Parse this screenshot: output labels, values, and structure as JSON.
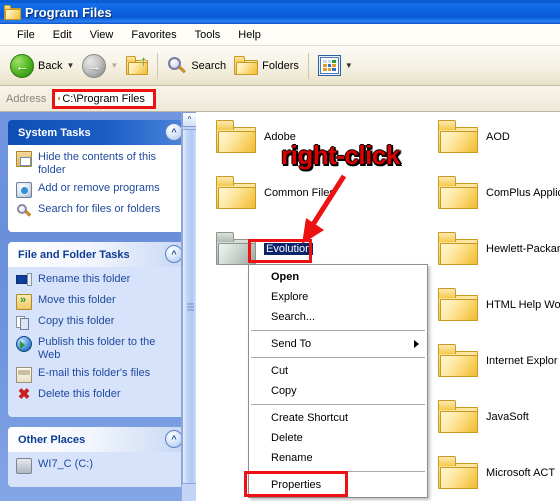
{
  "window": {
    "title": "Program Files",
    "icon": "folder-icon"
  },
  "menubar": {
    "items": [
      {
        "label": "File"
      },
      {
        "label": "Edit"
      },
      {
        "label": "View"
      },
      {
        "label": "Favorites"
      },
      {
        "label": "Tools"
      },
      {
        "label": "Help"
      }
    ]
  },
  "toolbar": {
    "back_label": "Back",
    "back_icon": "back-arrow-icon",
    "forward_icon": "forward-arrow-icon",
    "up_icon": "up-one-level-icon",
    "search_label": "Search",
    "search_icon": "magnifier-icon",
    "folders_label": "Folders",
    "folders_icon": "folders-icon",
    "views_icon": "views-icon",
    "dropdown_caret": "▼"
  },
  "address": {
    "label": "Address",
    "icon": "folder-icon",
    "value": "C:\\Program Files",
    "placeholder": "C:\\Program Files",
    "highlight_color": "#ee1111"
  },
  "sidebar": {
    "panels": [
      {
        "title": "System Tasks",
        "style": "blue",
        "collapse_icon": "chevron-up-icon",
        "tasks": [
          {
            "label": "Hide the contents of this folder",
            "icon": "hide-contents-icon"
          },
          {
            "label": "Add or remove programs",
            "icon": "add-remove-programs-icon"
          },
          {
            "label": "Search for files or folders",
            "icon": "search-icon"
          }
        ]
      },
      {
        "title": "File and Folder Tasks",
        "style": "white",
        "collapse_icon": "chevron-up-icon",
        "tasks": [
          {
            "label": "Rename this folder",
            "icon": "rename-icon"
          },
          {
            "label": "Move this folder",
            "icon": "move-icon"
          },
          {
            "label": "Copy this folder",
            "icon": "copy-icon"
          },
          {
            "label": "Publish this folder to the Web",
            "icon": "publish-web-icon"
          },
          {
            "label": "E-mail this folder's files",
            "icon": "email-icon"
          },
          {
            "label": "Delete this folder",
            "icon": "delete-x-icon"
          }
        ]
      },
      {
        "title": "Other Places",
        "style": "white",
        "collapse_icon": "chevron-up-icon",
        "tasks": [
          {
            "label": "WI7_C (C:)",
            "icon": "drive-icon"
          }
        ]
      }
    ],
    "scrollbar": {
      "up_arrow": "scroll-up-icon",
      "grip": "scrollbar-grip"
    }
  },
  "content": {
    "items": [
      {
        "name": "Adobe",
        "col": 0,
        "row": 0,
        "state": "normal"
      },
      {
        "name": "Common Files",
        "col": 0,
        "row": 1,
        "state": "normal"
      },
      {
        "name": "Evolution",
        "col": 0,
        "row": 2,
        "state": "selected"
      },
      {
        "name": "AOD",
        "col": 1,
        "row": 0,
        "state": "normal"
      },
      {
        "name": "ComPlus Applic",
        "col": 1,
        "row": 1,
        "state": "normal"
      },
      {
        "name": "Hewlett-Packar",
        "col": 1,
        "row": 2,
        "state": "normal"
      },
      {
        "name": "HTML Help Wor",
        "col": 1,
        "row": 3,
        "state": "normal"
      },
      {
        "name": "Internet Explor",
        "col": 1,
        "row": 4,
        "state": "normal"
      },
      {
        "name": "JavaSoft",
        "col": 1,
        "row": 5,
        "state": "normal"
      },
      {
        "name": "Microsoft ACT",
        "col": 1,
        "row": 6,
        "state": "normal"
      }
    ]
  },
  "annotation": {
    "text": "right-click",
    "color": "#dd0000",
    "arrow_icon": "red-arrow-icon"
  },
  "context_menu": {
    "items": [
      {
        "label": "Open",
        "type": "item",
        "bold": true,
        "submenu": false
      },
      {
        "label": "Explore",
        "type": "item",
        "bold": false,
        "submenu": false
      },
      {
        "label": "Search...",
        "type": "item",
        "bold": false,
        "submenu": false
      },
      {
        "label": "",
        "type": "separator"
      },
      {
        "label": "Send To",
        "type": "item",
        "bold": false,
        "submenu": true
      },
      {
        "label": "",
        "type": "separator"
      },
      {
        "label": "Cut",
        "type": "item",
        "bold": false,
        "submenu": false
      },
      {
        "label": "Copy",
        "type": "item",
        "bold": false,
        "submenu": false
      },
      {
        "label": "",
        "type": "separator"
      },
      {
        "label": "Create Shortcut",
        "type": "item",
        "bold": false,
        "submenu": false
      },
      {
        "label": "Delete",
        "type": "item",
        "bold": false,
        "submenu": false
      },
      {
        "label": "Rename",
        "type": "item",
        "bold": false,
        "submenu": false
      },
      {
        "label": "",
        "type": "separator"
      },
      {
        "label": "Properties",
        "type": "item",
        "bold": false,
        "submenu": false,
        "highlighted": true
      }
    ]
  }
}
